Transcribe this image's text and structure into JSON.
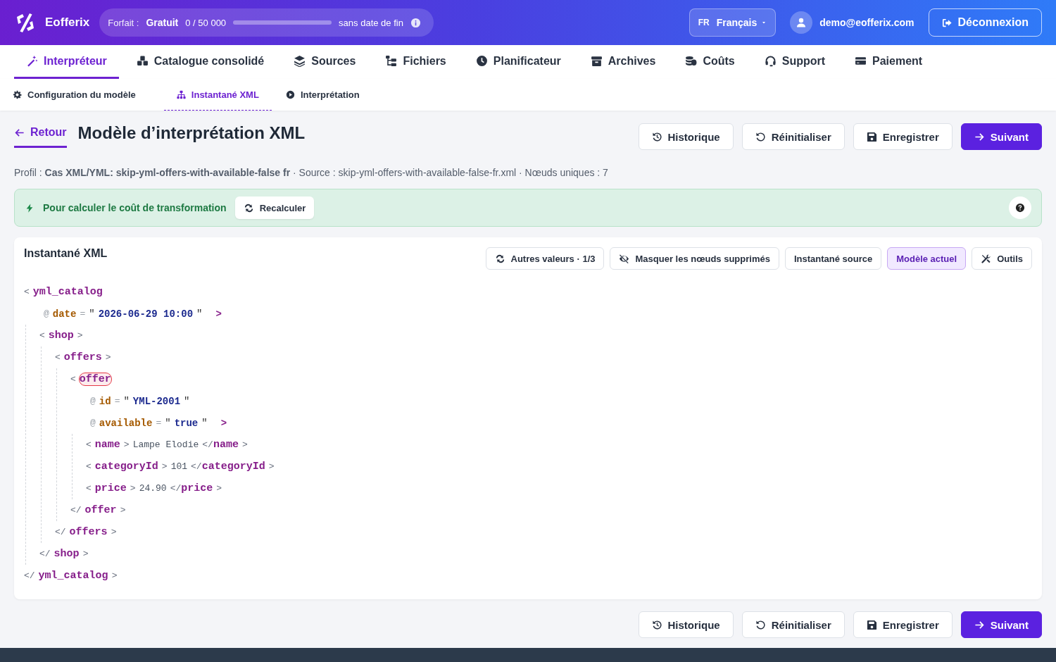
{
  "header": {
    "brand": "Eofferix",
    "plan": {
      "label": "Forfait :",
      "name": "Gratuit",
      "usage": "0 / 50 000",
      "level": 0,
      "expiry": "sans date de fin"
    },
    "language": {
      "code": "FR",
      "name": "Français"
    },
    "user": "demo@eofferix.com",
    "logout": "Déconnexion"
  },
  "nav": [
    {
      "label": "Interpréteur",
      "selected": true
    },
    {
      "label": "Catalogue consolidé",
      "selected": false
    },
    {
      "label": "Sources",
      "selected": false
    },
    {
      "label": "Fichiers",
      "selected": false
    },
    {
      "label": "Planificateur",
      "selected": false
    },
    {
      "label": "Archives",
      "selected": false
    },
    {
      "label": "Coûts",
      "selected": false
    },
    {
      "label": "Support",
      "selected": false
    },
    {
      "label": "Paiement",
      "selected": false
    }
  ],
  "sub_tabs": [
    {
      "label": "Configuration du modèle",
      "selected": false
    },
    {
      "label": "Instantané XML",
      "selected": true
    },
    {
      "label": "Interprétation",
      "selected": false
    }
  ],
  "page": {
    "back": "Retour",
    "title": "Modèle d’interprétation XML",
    "actions": [
      {
        "label": "Historique",
        "kind": "history"
      },
      {
        "label": "Réinitialiser",
        "kind": "reset"
      },
      {
        "label": "Enregistrer",
        "kind": "save"
      },
      {
        "label": "Suivant",
        "kind": "next"
      }
    ],
    "profile": "Profil : **Cas XML/YML: skip-yml-offers-with-available-false fr** · Source : skip-yml-offers-with-available-false-fr.xml · Nœuds uniques : 7",
    "notice": {
      "text": "Pour calculer le coût de transformation",
      "button": "Recalculer"
    }
  },
  "panel": {
    "title": "Instantané XML",
    "tools": [
      {
        "label": "Autres valeurs · 1/3",
        "selected": false
      },
      {
        "label": "Masquer les nœuds supprimés",
        "selected": false
      },
      {
        "label": "Instantané source",
        "selected": false
      },
      {
        "label": "Modèle actuel",
        "selected": true
      },
      {
        "label": "Outils",
        "selected": false
      }
    ],
    "syntax": {
      "open": "<",
      "close": ">",
      "end": "</",
      "attr": "@",
      "eq": "=",
      "quote": "\""
    },
    "tree": {
      "tag": "yml_catalog",
      "end_tag": "yml_catalog",
      "flagged": false,
      "attributes": [
        {
          "name": "date",
          "value": "2026-06-29 10:00"
        }
      ],
      "children": [
        {
          "tag": "shop",
          "end_tag": "shop",
          "flagged": false,
          "children": [
            {
              "tag": "offers",
              "end_tag": "offers",
              "flagged": false,
              "children": [
                {
                  "tag": "offer",
                  "end_tag": "offer",
                  "flagged": true,
                  "attributes": [
                    {
                      "name": "id",
                      "value": "YML-2001"
                    },
                    {
                      "name": "available",
                      "value": "true"
                    }
                  ],
                  "children": [
                    {
                      "tag": "name",
                      "end_tag": "name",
                      "flagged": false,
                      "text": "Lampe Elodie"
                    },
                    {
                      "tag": "categoryId",
                      "end_tag": "categoryId",
                      "flagged": false,
                      "text": "101"
                    },
                    {
                      "tag": "price",
                      "end_tag": "price",
                      "flagged": false,
                      "text": "24.90"
                    }
                  ]
                }
              ]
            }
          ]
        }
      ]
    }
  },
  "bottom_actions": [
    {
      "label": "Historique",
      "kind": "history"
    },
    {
      "label": "Réinitialiser",
      "kind": "reset"
    },
    {
      "label": "Enregistrer",
      "kind": "save"
    },
    {
      "label": "Suivant",
      "kind": "next"
    }
  ]
}
